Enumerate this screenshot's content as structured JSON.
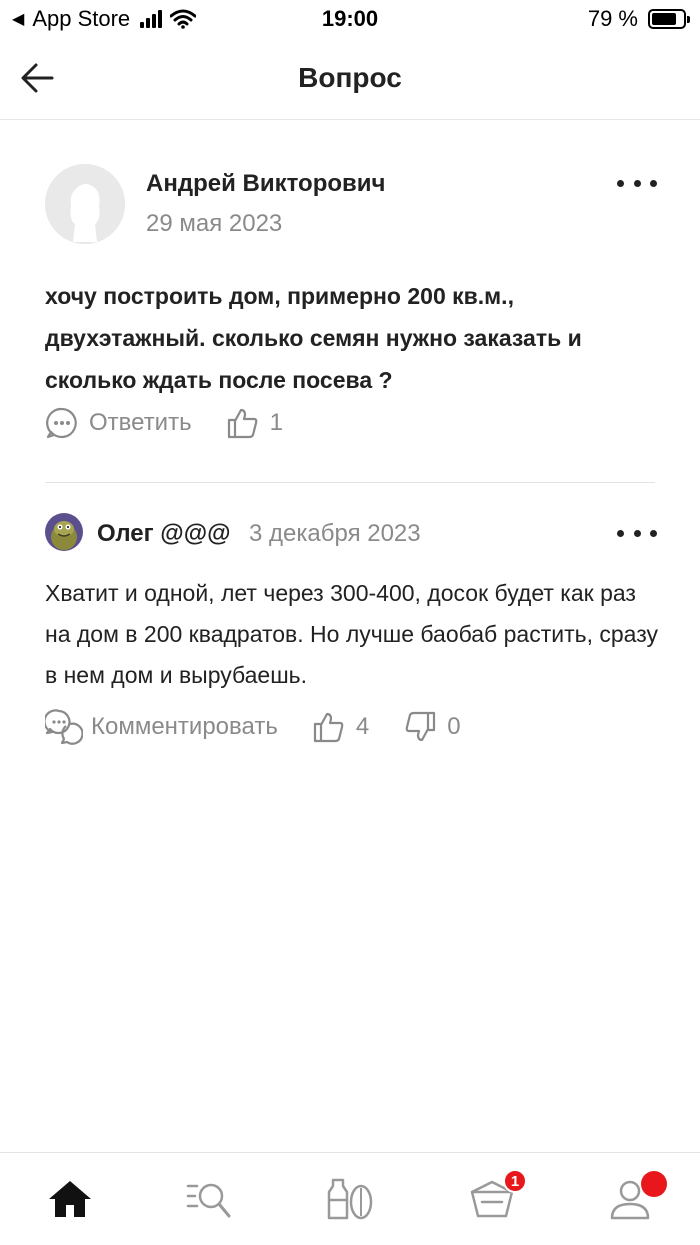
{
  "status_bar": {
    "back_app": "App Store",
    "time": "19:00",
    "battery": "79 %",
    "battery_level": 0.79
  },
  "header": {
    "title": "Вопрос"
  },
  "question": {
    "author": "Андрей Викторович",
    "date": "29 мая 2023",
    "text": "хочу построить дом, примерно 200 кв.м., двухэтажный.  сколько семян нужно заказать и сколько ждать после посева ?",
    "reply_label": "Ответить",
    "likes": "1"
  },
  "answer": {
    "author": "Олег @@@",
    "date": "3 декабря 2023",
    "text": "Хватит и одной, лет через 300-400,  досок будет как раз на дом в 200 квадратов.  Но лучше баобаб растить, сразу в нем дом и вырубаешь.",
    "comment_label": "Комментировать",
    "likes": "4",
    "dislikes": "0"
  },
  "tabbar": {
    "cart_badge": "1",
    "icons": [
      "home-icon",
      "search-list-icon",
      "products-icon",
      "cart-icon",
      "profile-icon"
    ]
  }
}
